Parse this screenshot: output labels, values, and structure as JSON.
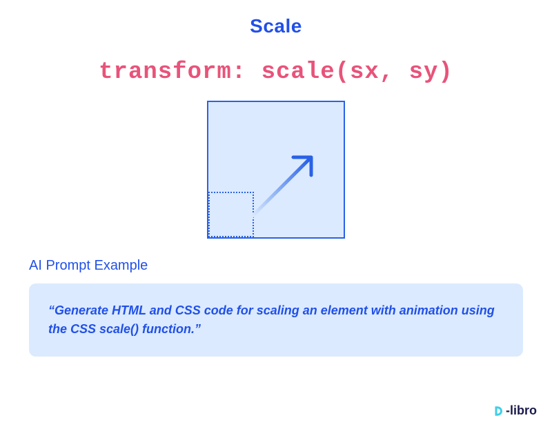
{
  "title": "Scale",
  "code": "transform: scale(sx, sy)",
  "section_label": "AI Prompt Example",
  "prompt_text": "“Generate HTML and CSS code for scaling an element with animation using the CSS scale() function.”",
  "logo": {
    "text": "-libro"
  },
  "colors": {
    "primary": "#2150e8",
    "accent": "#e8537a",
    "light_bg": "#dbeafe"
  }
}
